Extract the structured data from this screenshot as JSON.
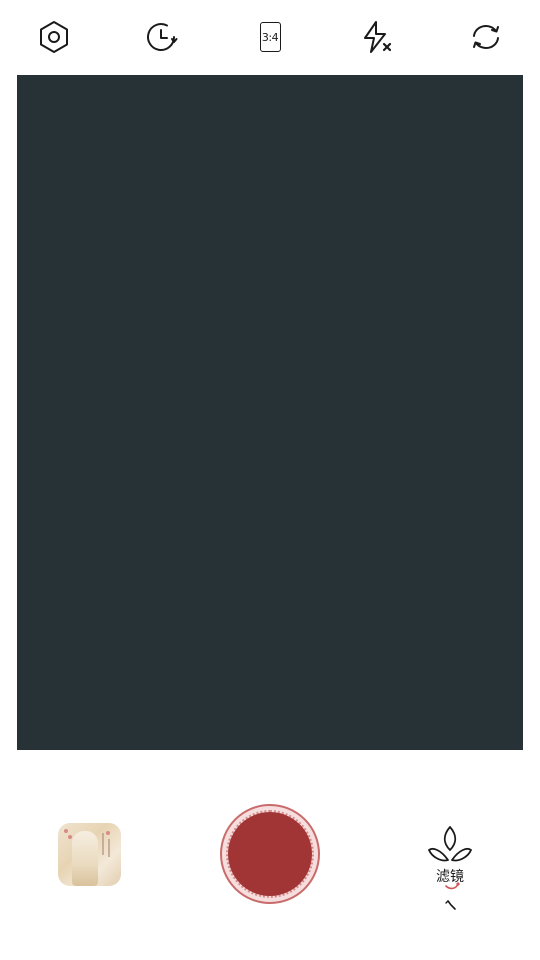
{
  "toolbar": {
    "settings_icon": "settings-hexagon-icon",
    "timer_icon": "timer-icon",
    "ratio_label": "3:4",
    "flash_icon": "flash-off-icon",
    "switch_icon": "camera-switch-icon"
  },
  "viewfinder": {
    "background": "#273236"
  },
  "controls": {
    "gallery_icon": "gallery-thumbnail",
    "shutter_color": "#a13535",
    "filter_label": "滤镜",
    "filter_icon": "filter-leaf-icon"
  }
}
